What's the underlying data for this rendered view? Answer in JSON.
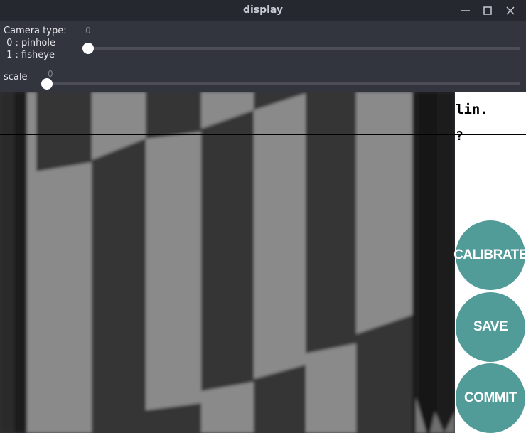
{
  "window": {
    "title": "display",
    "controls": [
      "minimize-icon",
      "maximize-icon",
      "close-icon"
    ]
  },
  "trackbars": [
    {
      "label": "Camera type:\n 0 : pinhole\n 1 : fisheye",
      "value": "0",
      "min": 0,
      "position_fraction": 0.0
    },
    {
      "label": "scale",
      "value": "0",
      "min": 0,
      "position_fraction": 0.0
    }
  ],
  "image": {
    "description": "grayscale checkerboard calibration pattern, distorted",
    "colors": {
      "light": "#8a8a8a",
      "dark": "#363636",
      "darkest": "#1f1f1f"
    }
  },
  "side_panel": {
    "status_line1": "lin.",
    "status_line2": "?",
    "buttons": [
      {
        "label": "CALIBRATE"
      },
      {
        "label": "SAVE"
      },
      {
        "label": "COMMIT"
      }
    ],
    "button_color": "#519b98"
  }
}
